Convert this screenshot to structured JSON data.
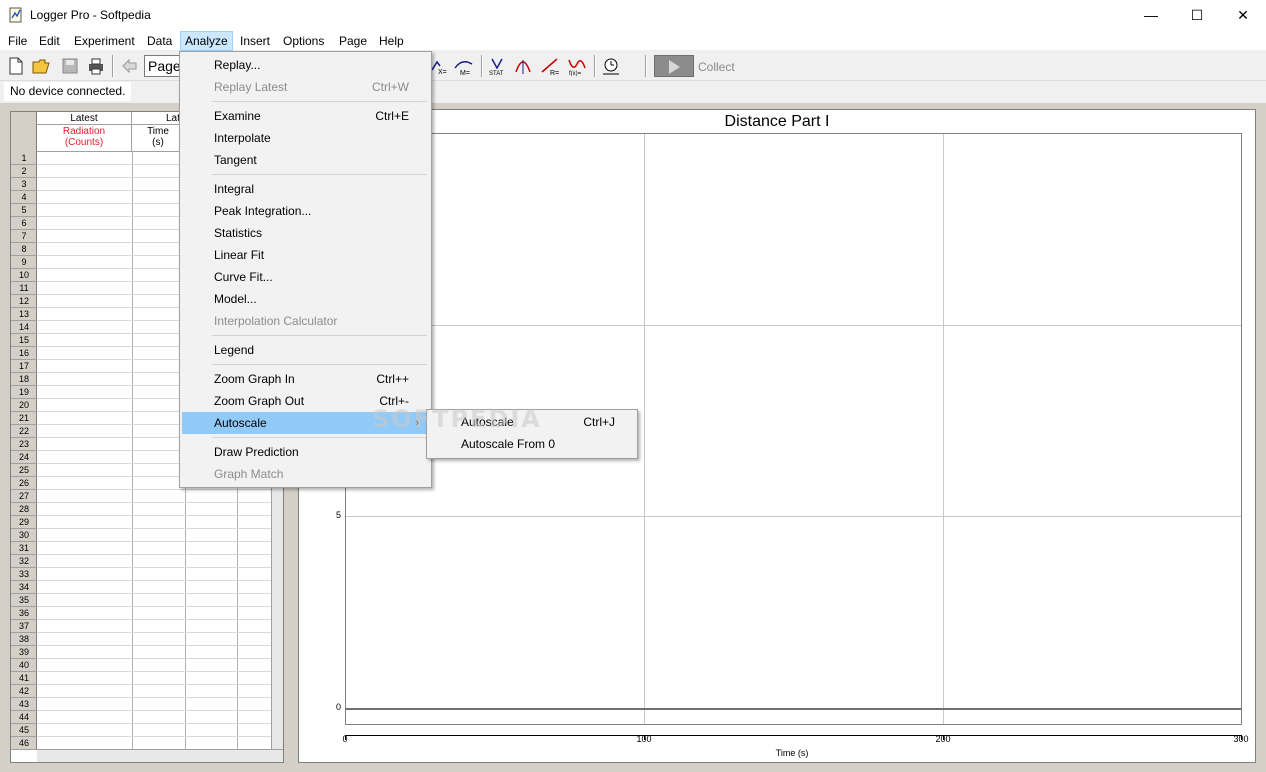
{
  "window": {
    "title": "Logger Pro - Softpedia",
    "controls": {
      "minimize": "—",
      "maximize": "☐",
      "close": "✕"
    }
  },
  "menubar": [
    "File",
    "Edit",
    "Experiment",
    "Data",
    "Analyze",
    "Insert",
    "Options",
    "Page",
    "Help"
  ],
  "toolbar": {
    "page_select": "Page",
    "collect_label": "Collect"
  },
  "status": {
    "device": "No device connected."
  },
  "table": {
    "columns": [
      {
        "group": "Latest",
        "name": "Radiation",
        "unit": "(Counts)",
        "name_color": "#e0202c"
      },
      {
        "group": "Lat",
        "name": "Time",
        "unit": "(s)"
      }
    ],
    "row_numbers": [
      "1",
      "2",
      "3",
      "4",
      "5",
      "6",
      "7",
      "8",
      "9",
      "10",
      "11",
      "12",
      "13",
      "14",
      "15",
      "16",
      "17",
      "18",
      "19",
      "20",
      "21",
      "22",
      "23",
      "24",
      "25",
      "26",
      "27",
      "28",
      "29",
      "30",
      "31",
      "32",
      "33",
      "34",
      "35",
      "36",
      "37",
      "38",
      "39",
      "40",
      "41",
      "42",
      "43",
      "44",
      "45",
      "46"
    ]
  },
  "graph": {
    "title": "Distance Part I",
    "xlabel": "Time (s)",
    "x_ticks": [
      "0",
      "100",
      "200",
      "300"
    ],
    "y_ticks": [
      "5",
      "0"
    ]
  },
  "analyze_menu": {
    "items": [
      {
        "label": "Replay...",
        "shortcut": "",
        "disabled": false
      },
      {
        "label": "Replay Latest",
        "shortcut": "Ctrl+W",
        "disabled": true
      },
      {
        "label": "Examine",
        "shortcut": "Ctrl+E",
        "disabled": false
      },
      {
        "label": "Interpolate",
        "shortcut": "",
        "disabled": false
      },
      {
        "label": "Tangent",
        "shortcut": "",
        "disabled": false
      },
      {
        "label": "Integral",
        "shortcut": "",
        "disabled": false
      },
      {
        "label": "Peak Integration...",
        "shortcut": "",
        "disabled": false
      },
      {
        "label": "Statistics",
        "shortcut": "",
        "disabled": false
      },
      {
        "label": "Linear Fit",
        "shortcut": "",
        "disabled": false
      },
      {
        "label": "Curve Fit...",
        "shortcut": "",
        "disabled": false
      },
      {
        "label": "Model...",
        "shortcut": "",
        "disabled": false
      },
      {
        "label": "Interpolation Calculator",
        "shortcut": "",
        "disabled": true
      },
      {
        "label": "Legend",
        "shortcut": "",
        "disabled": false
      },
      {
        "label": "Zoom Graph In",
        "shortcut": "Ctrl++",
        "disabled": false
      },
      {
        "label": "Zoom Graph Out",
        "shortcut": "Ctrl+-",
        "disabled": false
      },
      {
        "label": "Autoscale",
        "shortcut": "",
        "disabled": false
      },
      {
        "label": "Draw Prediction",
        "shortcut": "",
        "disabled": false
      },
      {
        "label": "Graph Match",
        "shortcut": "",
        "disabled": true
      }
    ],
    "submenu_arrow": "›"
  },
  "autoscale_submenu": {
    "items": [
      {
        "label": "Autoscale",
        "shortcut": "Ctrl+J"
      },
      {
        "label": "Autoscale From 0",
        "shortcut": ""
      }
    ]
  },
  "watermark": "SOFTPEDIA",
  "colors": {
    "menu_highlight": "#91c9f7",
    "menubar_active": "#cce8ff"
  }
}
